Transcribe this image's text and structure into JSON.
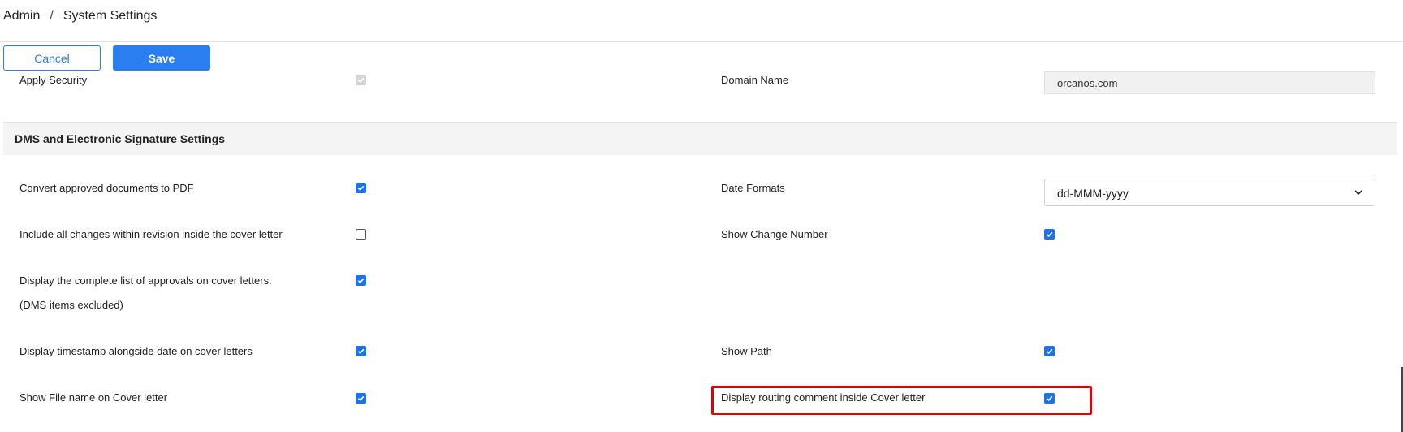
{
  "breadcrumb": {
    "root": "Admin",
    "separator": "/",
    "current": "System Settings"
  },
  "toolbar": {
    "cancel_label": "Cancel",
    "save_label": "Save"
  },
  "security": {
    "apply_security_label": "Apply Security",
    "apply_security_checked": true,
    "domain_name_label": "Domain Name",
    "domain_name_value": "orcanos.com"
  },
  "dms_section": {
    "title": "DMS and Electronic Signature Settings",
    "left": [
      {
        "label": "Convert approved documents to PDF",
        "checked": true
      },
      {
        "label": "Include all changes within revision inside the cover letter",
        "checked": false
      },
      {
        "label": "Display the complete list of approvals on cover letters.",
        "label2": "(DMS items excluded)",
        "checked": true
      },
      {
        "label": "Display timestamp alongside date on cover letters",
        "checked": true
      },
      {
        "label": "Show File name on Cover letter",
        "checked": true
      }
    ],
    "right": {
      "date_formats_label": "Date Formats",
      "date_formats_value": "dd-MMM-yyyy",
      "show_change_number_label": "Show Change Number",
      "show_change_number_checked": true,
      "show_path_label": "Show Path",
      "show_path_checked": true,
      "routing_comment_label": "Display routing comment inside Cover letter",
      "routing_comment_checked": true
    }
  },
  "colors": {
    "accent": "#1a73e8",
    "save_bg": "#2b7ef0",
    "highlight": "#e60000",
    "section_bg": "#f4f4f4"
  }
}
